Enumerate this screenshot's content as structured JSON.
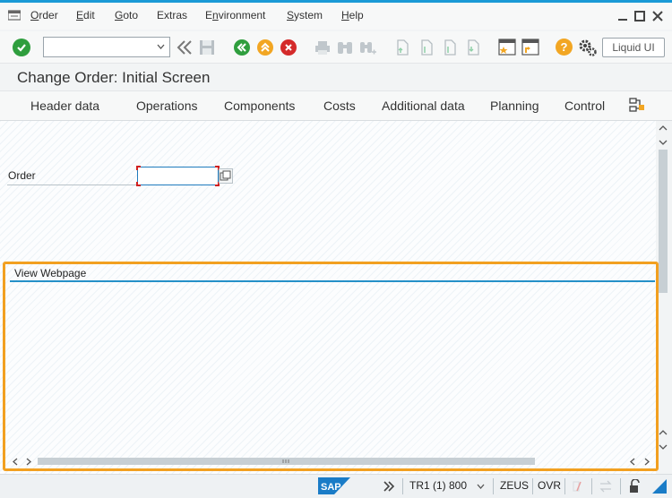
{
  "menubar": {
    "items": [
      "Order",
      "Edit",
      "Goto",
      "Extras",
      "Environment",
      "System",
      "Help"
    ],
    "underlined": [
      "O",
      "E",
      "G",
      "",
      "n",
      "S",
      "H"
    ]
  },
  "toolbar": {
    "command_field_value": "",
    "liquid_ui_label": "Liquid UI"
  },
  "screen": {
    "title": "Change Order: Initial Screen"
  },
  "tabs": [
    "Header data",
    "Operations",
    "Components",
    "Costs",
    "Additional data",
    "Planning",
    "Control"
  ],
  "form": {
    "order_label": "Order",
    "order_value": ""
  },
  "webpage": {
    "title": "View Webpage"
  },
  "status": {
    "system": "TR1 (1) 800",
    "server": "ZEUS",
    "mode": "OVR"
  },
  "colors": {
    "accent": "#1a9ad6",
    "frame_highlight": "#f2a020",
    "green": "#2f9e3e",
    "orange": "#f2a623",
    "red": "#d42a2a",
    "help": "#f2a623"
  },
  "icons": {
    "menu": "menu-list-icon",
    "enter": "check-icon",
    "back": "back-icon",
    "exit": "exit-icon",
    "cancel": "cancel-icon",
    "help": "help-icon",
    "settings": "gear-icon"
  }
}
